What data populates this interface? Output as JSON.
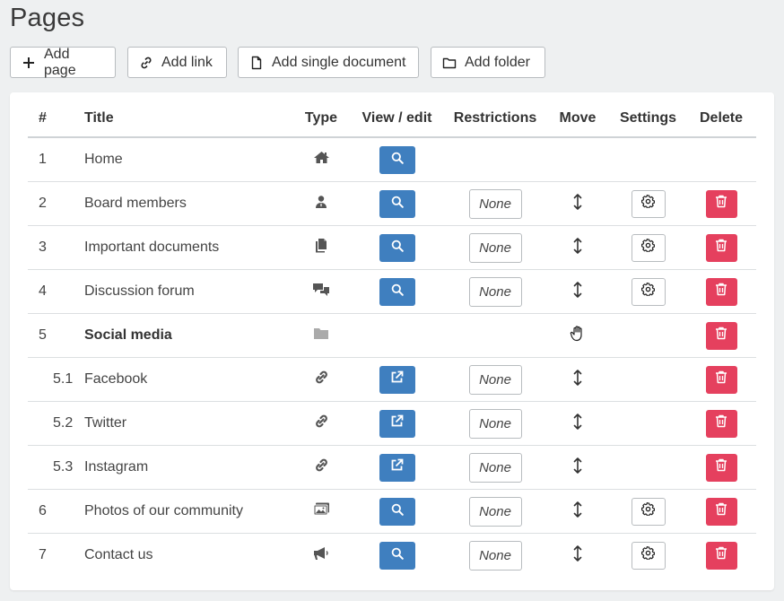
{
  "page": {
    "title": "Pages"
  },
  "toolbar": {
    "add_page": "Add page",
    "add_link": "Add link",
    "add_single_document": "Add single document",
    "add_folder": "Add folder"
  },
  "table": {
    "headers": {
      "num": "#",
      "title": "Title",
      "type": "Type",
      "view_edit": "View / edit",
      "restrictions": "Restrictions",
      "move": "Move",
      "settings": "Settings",
      "delete": "Delete"
    },
    "rows": [
      {
        "num": "1",
        "title": "Home",
        "type_icon": "home-icon",
        "view_icon": "search-icon",
        "restriction": "",
        "move_icon": "",
        "settings": false,
        "delete": false,
        "bold": false,
        "sub": false
      },
      {
        "num": "2",
        "title": "Board members",
        "type_icon": "user-icon",
        "view_icon": "search-icon",
        "restriction": "None",
        "move_icon": "move-vertical-icon",
        "settings": true,
        "delete": true,
        "bold": false,
        "sub": false
      },
      {
        "num": "3",
        "title": "Important documents",
        "type_icon": "documents-icon",
        "view_icon": "search-icon",
        "restriction": "None",
        "move_icon": "move-vertical-icon",
        "settings": true,
        "delete": true,
        "bold": false,
        "sub": false
      },
      {
        "num": "4",
        "title": "Discussion forum",
        "type_icon": "forum-icon",
        "view_icon": "search-icon",
        "restriction": "None",
        "move_icon": "move-vertical-icon",
        "settings": true,
        "delete": true,
        "bold": false,
        "sub": false
      },
      {
        "num": "5",
        "title": "Social media",
        "type_icon": "folder-icon",
        "view_icon": "",
        "restriction": "",
        "move_icon": "grab-hand-icon",
        "settings": false,
        "delete": true,
        "bold": true,
        "sub": false
      },
      {
        "num": "5.1",
        "title": "Facebook",
        "type_icon": "link-icon",
        "view_icon": "external-link-icon",
        "restriction": "None",
        "move_icon": "move-vertical-icon",
        "settings": false,
        "delete": true,
        "bold": false,
        "sub": true
      },
      {
        "num": "5.2",
        "title": "Twitter",
        "type_icon": "link-icon",
        "view_icon": "external-link-icon",
        "restriction": "None",
        "move_icon": "move-vertical-icon",
        "settings": false,
        "delete": true,
        "bold": false,
        "sub": true
      },
      {
        "num": "5.3",
        "title": "Instagram",
        "type_icon": "link-icon",
        "view_icon": "external-link-icon",
        "restriction": "None",
        "move_icon": "move-vertical-icon",
        "settings": false,
        "delete": true,
        "bold": false,
        "sub": true
      },
      {
        "num": "6",
        "title": "Photos of our community",
        "type_icon": "image-icon",
        "view_icon": "search-icon",
        "restriction": "None",
        "move_icon": "move-vertical-icon",
        "settings": true,
        "delete": true,
        "bold": false,
        "sub": false
      },
      {
        "num": "7",
        "title": "Contact us",
        "type_icon": "megaphone-icon",
        "view_icon": "search-icon",
        "restriction": "None",
        "move_icon": "move-vertical-icon",
        "settings": true,
        "delete": true,
        "bold": false,
        "sub": false
      }
    ]
  },
  "colors": {
    "primary": "#3f7fbf",
    "danger": "#e5405e",
    "background": "#eef0f1"
  }
}
